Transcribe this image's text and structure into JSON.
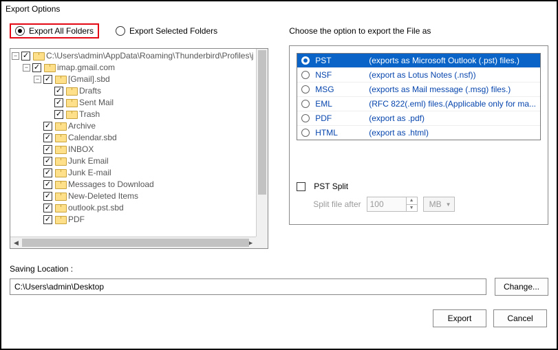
{
  "window": {
    "title": "Export Options"
  },
  "radios": {
    "all": "Export All Folders",
    "selected": "Export Selected Folders"
  },
  "tree": {
    "root_path": "C:\\Users\\admin\\AppData\\Roaming\\Thunderbird\\Profiles\\j",
    "account": "imap.gmail.com",
    "gmail_sbd": "[Gmail].sbd",
    "drafts": "Drafts",
    "sent_mail": "Sent Mail",
    "trash": "Trash",
    "archive": "Archive",
    "calendar_sbd": "Calendar.sbd",
    "inbox": "INBOX",
    "junk_email": "Junk Email",
    "junk_e_mail": "Junk E-mail",
    "messages_to_download": "Messages to Download",
    "new_deleted": "New-Deleted Items",
    "outlook_pst_sbd": "outlook.pst.sbd",
    "pdf": "PDF"
  },
  "choose_label": "Choose the option to export the File as",
  "formats": [
    {
      "name": "PST",
      "desc": "(exports as Microsoft Outlook (.pst) files.)",
      "selected": true
    },
    {
      "name": "NSF",
      "desc": "(export as Lotus Notes (.nsf))",
      "selected": false
    },
    {
      "name": "MSG",
      "desc": "(exports as Mail message (.msg) files.)",
      "selected": false
    },
    {
      "name": "EML",
      "desc": "(RFC 822(.eml) files.(Applicable only for ma...",
      "selected": false
    },
    {
      "name": "PDF",
      "desc": "(export as .pdf)",
      "selected": false
    },
    {
      "name": "HTML",
      "desc": "(export as .html)",
      "selected": false
    }
  ],
  "pst_split": {
    "label": "PST Split",
    "split_after_label": "Split file after",
    "value": "100",
    "unit": "MB"
  },
  "saving": {
    "label": "Saving Location :",
    "path": "C:\\Users\\admin\\Desktop",
    "change": "Change..."
  },
  "footer": {
    "export": "Export",
    "cancel": "Cancel"
  }
}
